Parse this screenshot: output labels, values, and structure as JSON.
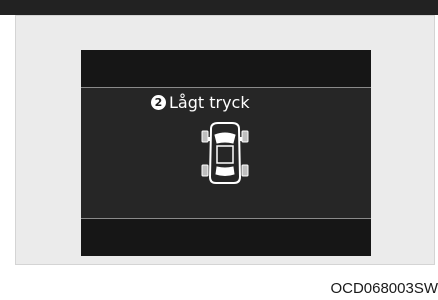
{
  "display": {
    "warning_number": "2",
    "warning_title": "Lågt tryck"
  },
  "figure": {
    "code": "OCD068003SW"
  },
  "colors": {
    "screen": "#262626",
    "screen_band": "#161616",
    "divider": "#8a8a8a",
    "text": "#ffffff",
    "tire_highlight": "#bfbfbf"
  },
  "icons": {
    "vehicle": "car-top-view-icon",
    "badge": "circled-number-icon"
  }
}
